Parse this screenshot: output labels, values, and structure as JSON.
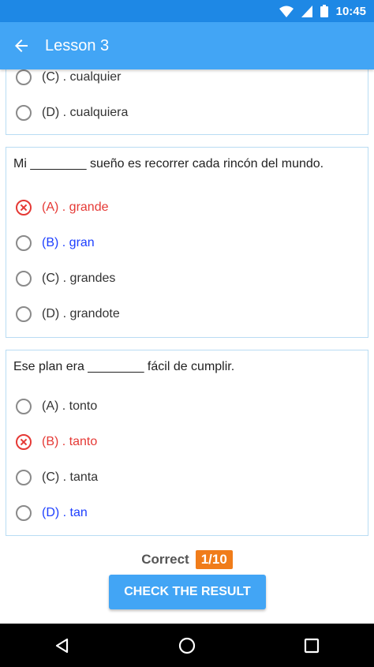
{
  "status_bar": {
    "time": "10:45"
  },
  "app_bar": {
    "title": "Lesson 3"
  },
  "cards": [
    {
      "question": "",
      "options": [
        {
          "text": "(C) . cualquier",
          "state": "normal"
        },
        {
          "text": "(D) . cualquiera",
          "state": "normal"
        }
      ]
    },
    {
      "question": "Mi ________ sueño es recorrer cada rincón del mundo.",
      "options": [
        {
          "text": "(A) . grande",
          "state": "wrong"
        },
        {
          "text": "(B) . gran",
          "state": "correct"
        },
        {
          "text": "(C) . grandes",
          "state": "normal"
        },
        {
          "text": "(D) . grandote",
          "state": "normal"
        }
      ]
    },
    {
      "question": "Ese plan era ________ fácil de cumplir.",
      "options": [
        {
          "text": "(A) . tonto",
          "state": "normal"
        },
        {
          "text": "(B) . tanto",
          "state": "wrong"
        },
        {
          "text": "(C) . tanta",
          "state": "normal"
        },
        {
          "text": "(D) . tan",
          "state": "correct"
        }
      ]
    }
  ],
  "score": {
    "label": "Correct",
    "value": "1/10"
  },
  "check_button": {
    "label": "CHECK THE RESULT"
  },
  "colors": {
    "status_bar": "#1e88e5",
    "app_bar": "#42a5f5",
    "wrong": "#e53935",
    "correct": "#1e40ff",
    "badge": "#f07c1a"
  },
  "icons": {
    "status": [
      "wifi-icon",
      "signal-icon",
      "battery-icon"
    ],
    "app_bar": "back-arrow-icon",
    "nav": [
      "back-triangle-icon",
      "home-circle-icon",
      "recents-square-icon"
    ]
  }
}
